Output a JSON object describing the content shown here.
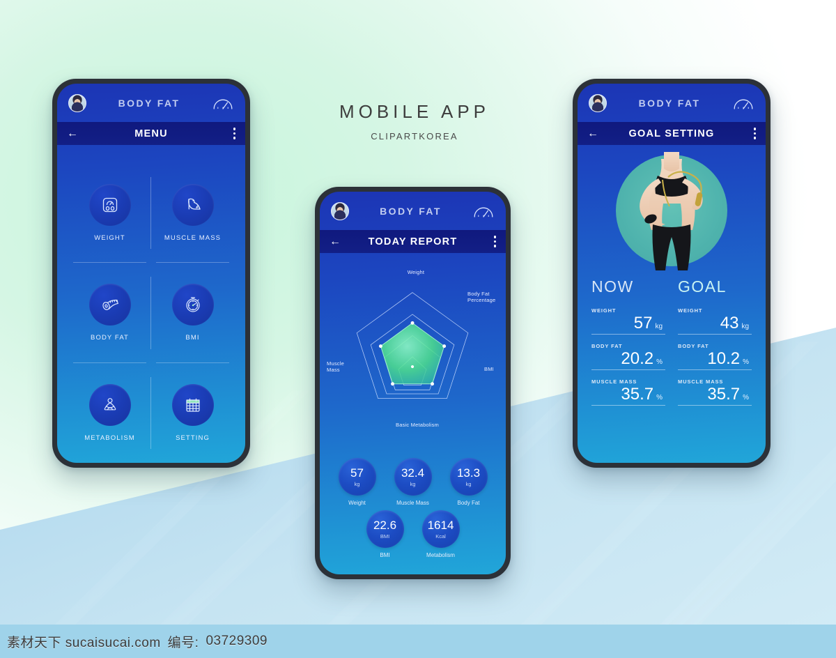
{
  "background": {
    "mint": "#cdf5df",
    "lightblue": "#bfe0f0",
    "accent_green": "#5fe08a",
    "accent_teal": "#4fb3ad",
    "phone_blue_top": "#1c35b5",
    "phone_blue_bottom": "#21a6d9",
    "navy_bar": "#111c80"
  },
  "heading": {
    "title": "MOBILE APP",
    "subtitle": "CLIPARTKOREA"
  },
  "watermark": {
    "site": "素材天下 sucaisucai.com",
    "id_label": "编号:",
    "id_value": "03729309"
  },
  "appbar": {
    "title": "BODY FAT",
    "avatar_icon": "user-avatar-photo",
    "gauge_icon": "speedometer-icon"
  },
  "menu_screen": {
    "subbar_title": "MENU",
    "back_icon": "back-arrow-icon",
    "overflow_icon": "kebab-menu-icon",
    "items": [
      {
        "label": "WEIGHT",
        "icon": "weight-scale-icon"
      },
      {
        "label": "MUSCLE MASS",
        "icon": "flexed-biceps-icon"
      },
      {
        "label": "BODY FAT",
        "icon": "tape-measure-icon"
      },
      {
        "label": "BMI",
        "icon": "stopwatch-icon"
      },
      {
        "label": "METABOLISM",
        "icon": "meditation-pose-icon"
      },
      {
        "label": "SETTING",
        "icon": "calendar-icon"
      }
    ]
  },
  "report_screen": {
    "subbar_title": "TODAY REPORT",
    "back_icon": "back-arrow-icon",
    "overflow_icon": "kebab-menu-icon",
    "stats": [
      {
        "value": "57",
        "unit": "kg",
        "caption": "Weight"
      },
      {
        "value": "32.4",
        "unit": "kg",
        "caption": "Muscle Mass"
      },
      {
        "value": "13.3",
        "unit": "kg",
        "caption": "Body Fat"
      },
      {
        "value": "22.6",
        "unit": "BMI",
        "caption": "BMI"
      },
      {
        "value": "1614",
        "unit": "Kcal",
        "caption": "Metabolism"
      }
    ]
  },
  "goal_screen": {
    "subbar_title": "GOAL SETTING",
    "back_icon": "back-arrow-icon",
    "overflow_icon": "kebab-menu-icon",
    "hero_icon": "fitness-woman-photo",
    "now": {
      "heading": "NOW",
      "metrics": [
        {
          "label": "WEIGHT",
          "value": "57",
          "unit": "kg"
        },
        {
          "label": "BODY FAT",
          "value": "20.2",
          "unit": "%"
        },
        {
          "label": "MUSCLE MASS",
          "value": "35.7",
          "unit": "%"
        }
      ]
    },
    "goal": {
      "heading": "GOAL",
      "metrics": [
        {
          "label": "WEIGHT",
          "value": "43",
          "unit": "kg"
        },
        {
          "label": "BODY FAT",
          "value": "10.2",
          "unit": "%"
        },
        {
          "label": "MUSCLE MASS",
          "value": "35.7",
          "unit": "%"
        }
      ]
    }
  },
  "chart_data": {
    "type": "radar",
    "title": "Today Report",
    "axes": [
      "Weight",
      "Body Fat Percentage",
      "BMI",
      "Basic Metabolism",
      "Muscle Mass"
    ],
    "rings": 4,
    "max": 100,
    "series": [
      {
        "name": "Today",
        "values": [
          62,
          62,
          62,
          58,
          52
        ],
        "fill": "#5fe08a"
      }
    ],
    "grid": true,
    "legend": "none"
  }
}
